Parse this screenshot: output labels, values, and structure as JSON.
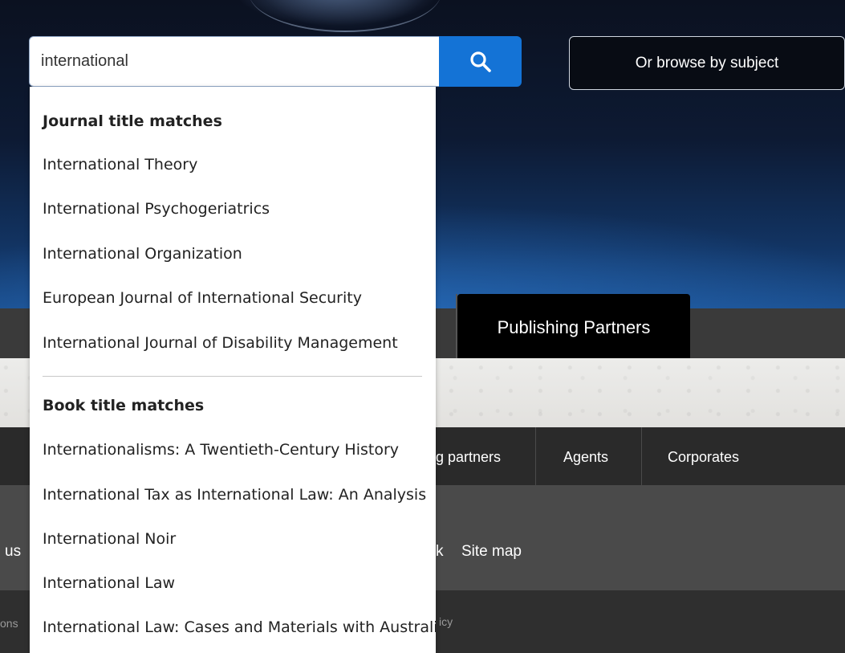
{
  "search": {
    "value": "international"
  },
  "browse_label": "Or browse by subject",
  "main_nav": {
    "publishing_partners": "Publishing Partners"
  },
  "sub_nav": {
    "partners_partial": "g partners",
    "agents": "Agents",
    "corporates": "Corporates"
  },
  "footer": {
    "left_partial": "us",
    "k_partial": "k",
    "site_map": "Site map",
    "bottom_left_partial": "ons",
    "bottom_right_partial": "icy"
  },
  "dropdown": {
    "journal_heading": "Journal title matches",
    "journal_items": [
      "International Theory",
      "International Psychogeriatrics",
      "International Organization",
      "European Journal of International Security",
      "International Journal of Disability Management"
    ],
    "book_heading": "Book title matches",
    "book_items": [
      "Internationalisms: A Twentieth-Century History",
      "International Tax as International Law: An Analysis",
      "International Noir",
      "International Law",
      "International Law: Cases and Materials with Australian Perspectives"
    ]
  }
}
